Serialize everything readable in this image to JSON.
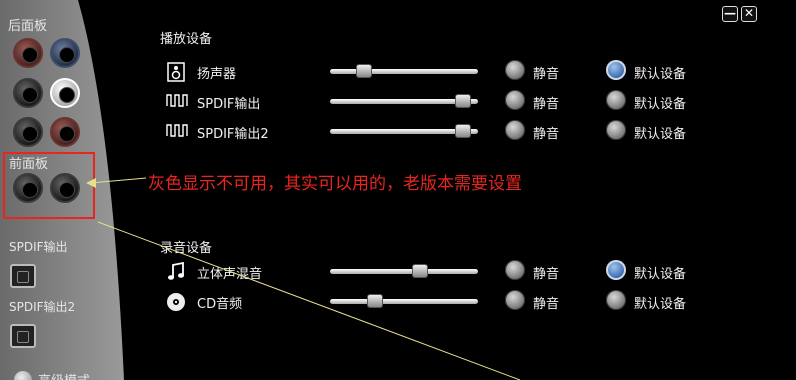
{
  "side": {
    "back_panel": "后面板",
    "front_panel": "前面板",
    "spdif_out": "SPDIF输出",
    "spdif_out2": "SPDIF输出2",
    "advanced_mode": "高级模式"
  },
  "window_buttons": {
    "minimize": "—",
    "close": "✕"
  },
  "playback": {
    "title": "播放设备",
    "mute_label": "静音",
    "default_label": "默认设备",
    "devices": [
      {
        "name": "扬声器",
        "icon": "speaker-icon",
        "volume": 0.2,
        "muted": false,
        "is_default": true
      },
      {
        "name": "SPDIF输出",
        "icon": "spdif-wave-icon",
        "volume": 0.95,
        "muted": false,
        "is_default": false
      },
      {
        "name": "SPDIF输出2",
        "icon": "spdif-wave-icon",
        "volume": 0.95,
        "muted": false,
        "is_default": false
      }
    ]
  },
  "recording": {
    "title": "录音设备",
    "mute_label": "静音",
    "default_label": "默认设备",
    "devices": [
      {
        "name": "立体声混音",
        "icon": "music-note-icon",
        "volume": 0.62,
        "muted": false,
        "is_default": true
      },
      {
        "name": "CD音频",
        "icon": "cd-icon",
        "volume": 0.28,
        "muted": false,
        "is_default": false
      }
    ]
  },
  "annotation": "灰色显示不可用，其实可以用的，老版本需要设置",
  "colors": {
    "annotation": "#e8251f",
    "radio_selected": "#2d5fa8"
  }
}
